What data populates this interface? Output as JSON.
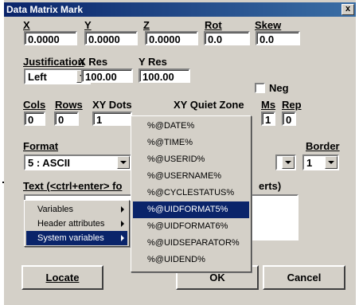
{
  "window": {
    "title": "Data Matrix Mark",
    "close_label": "x"
  },
  "labels": {
    "x": "X",
    "y": "Y",
    "z": "Z",
    "rot": "Rot",
    "skew": "Skew",
    "justification": "Justification",
    "xres": "X Res",
    "yres": "Y Res",
    "neg": "Neg",
    "cols": "Cols",
    "rows": "Rows",
    "xydots": "XY Dots",
    "xyquiet": "XY Quiet Zone",
    "ms": "Ms",
    "rep": "Rep",
    "format": "Format",
    "border": "Border",
    "text_left": "Text (<ctrl+enter> fo",
    "text_right": "erts)"
  },
  "fields": {
    "x": "0.0000",
    "y": "0.0000",
    "z": "0.0000",
    "rot": "0.0",
    "skew": "0.0",
    "justification": "Left",
    "xres": "100.00",
    "yres": "100.00",
    "cols": "0",
    "rows": "0",
    "xydots": "1",
    "ms": "1",
    "rep": "0",
    "format": "5 : ASCII",
    "border": "1"
  },
  "buttons": {
    "locate": "Locate",
    "ok": "OK",
    "cancel": "Cancel"
  },
  "context_menu": {
    "items": [
      {
        "label": "Variables",
        "has_submenu": true,
        "selected": false
      },
      {
        "label": "Header attributes",
        "has_submenu": true,
        "selected": false
      },
      {
        "label": "System variables",
        "has_submenu": true,
        "selected": true
      }
    ]
  },
  "submenu": {
    "items": [
      {
        "label": "%@DATE%",
        "selected": false
      },
      {
        "label": "%@TIME%",
        "selected": false
      },
      {
        "label": "%@USERID%",
        "selected": false
      },
      {
        "label": "%@USERNAME%",
        "selected": false
      },
      {
        "label": "%@CYCLESTATUS%",
        "selected": false
      },
      {
        "label": "%@UIDFORMAT5%",
        "selected": true
      },
      {
        "label": "%@UIDFORMAT6%",
        "selected": false
      },
      {
        "label": "%@UIDSEPARATOR%",
        "selected": false
      },
      {
        "label": "%@UIDEND%",
        "selected": false
      }
    ]
  }
}
